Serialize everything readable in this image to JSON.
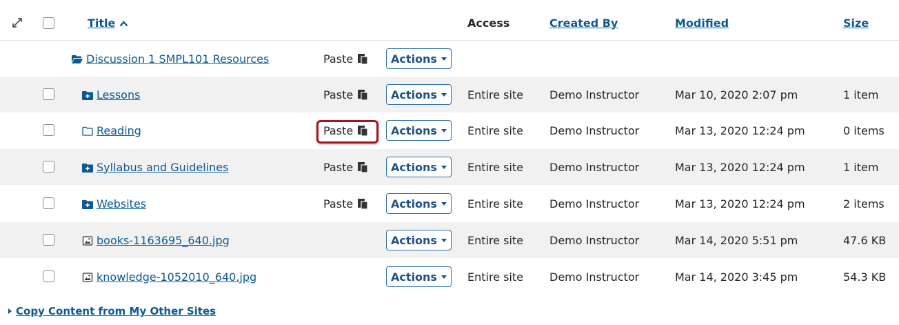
{
  "header": {
    "title": "Title",
    "access": "Access",
    "created_by": "Created By",
    "modified": "Modified",
    "size": "Size"
  },
  "parent": {
    "title": "Discussion 1 SMPL101 Resources",
    "paste": "Paste",
    "actions": "Actions"
  },
  "rows": [
    {
      "title": "Lessons",
      "icon": "folder-plus-icon",
      "paste": "Paste",
      "actions": "Actions",
      "access": "Entire site",
      "created_by": "Demo Instructor",
      "modified": "Mar 10, 2020 2:07 pm",
      "size": "1 item"
    },
    {
      "title": "Reading",
      "icon": "folder-empty-icon",
      "paste": "Paste",
      "actions": "Actions",
      "access": "Entire site",
      "created_by": "Demo Instructor",
      "modified": "Mar 13, 2020 12:24 pm",
      "size": "0 items"
    },
    {
      "title": "Syllabus and Guidelines",
      "icon": "folder-plus-icon",
      "paste": "Paste",
      "actions": "Actions",
      "access": "Entire site",
      "created_by": "Demo Instructor",
      "modified": "Mar 13, 2020 12:24 pm",
      "size": "1 item"
    },
    {
      "title": "Websites",
      "icon": "folder-plus-icon",
      "paste": "Paste",
      "actions": "Actions",
      "access": "Entire site",
      "created_by": "Demo Instructor",
      "modified": "Mar 13, 2020 12:24 pm",
      "size": "2 items"
    },
    {
      "title": "books-1163695_640.jpg",
      "icon": "image-file-icon",
      "actions": "Actions",
      "access": "Entire site",
      "created_by": "Demo Instructor",
      "modified": "Mar 14, 2020 5:51 pm",
      "size": "47.6 KB"
    },
    {
      "title": "knowledge-1052010_640.jpg",
      "icon": "image-file-icon",
      "actions": "Actions",
      "access": "Entire site",
      "created_by": "Demo Instructor",
      "modified": "Mar 14, 2020 3:45 pm",
      "size": "54.3 KB"
    }
  ],
  "footer": {
    "copy_content": "Copy Content from My Other Sites"
  },
  "colors": {
    "link": "#0b5a94",
    "highlight": "#a3161d",
    "row_alt": "#f1f1f1"
  }
}
